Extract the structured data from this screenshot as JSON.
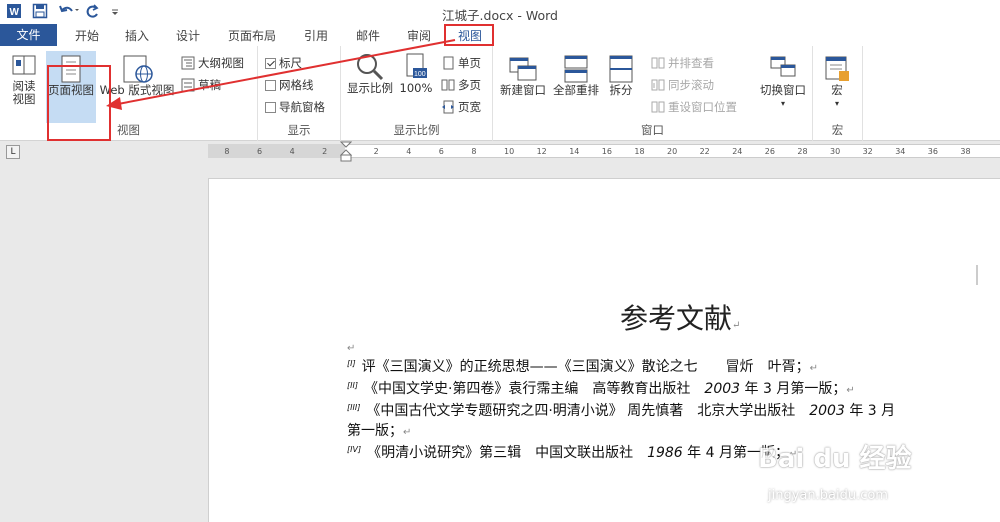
{
  "window": {
    "title": "江城子.docx - Word"
  },
  "qat": {
    "undo_icon": "undo-icon",
    "redo_icon": "redo-icon",
    "save_icon": "save-icon",
    "word_icon": "word-icon"
  },
  "tabs": {
    "file": "文件",
    "home": "开始",
    "insert": "插入",
    "design": "设计",
    "layout": "页面布局",
    "references": "引用",
    "mailings": "邮件",
    "review": "审阅",
    "view": "视图"
  },
  "ribbon": {
    "views": {
      "read_mode": [
        "阅读",
        "视图"
      ],
      "print_layout": "页面视图",
      "web_layout": "Web 版式视图",
      "outline": "大纲视图",
      "draft": "草稿",
      "label": "视图"
    },
    "show": {
      "ruler": "标尺",
      "gridlines": "网格线",
      "nav_pane": "导航窗格",
      "label": "显示",
      "ruler_checked": true,
      "gridlines_checked": false,
      "nav_checked": false
    },
    "zoom": {
      "zoom": "显示比例",
      "hundred": "100%",
      "one_page": "单页",
      "multi_page": "多页",
      "page_width": "页宽",
      "label": "显示比例"
    },
    "window": {
      "new_window": "新建窗口",
      "arrange_all": "全部重排",
      "split": "拆分",
      "side_by_side": "并排查看",
      "sync_scroll": "同步滚动",
      "reset_pos": "重设窗口位置",
      "switch_windows": "切换窗口",
      "label": "窗口"
    },
    "macros": {
      "macros": "宏",
      "label": "宏"
    }
  },
  "ruler": {
    "ticks_left": [
      "8",
      "6",
      "4",
      "2"
    ],
    "ticks_right": [
      "2",
      "4",
      "6",
      "8",
      "10",
      "12",
      "14",
      "16",
      "18",
      "20",
      "22",
      "24",
      "26",
      "28",
      "30",
      "32",
      "34",
      "36",
      "38",
      "40"
    ],
    "tab_selector": "L"
  },
  "document": {
    "title": "参考文献",
    "refs": [
      {
        "num": "[I]",
        "text": "评《三国演义》的正统思想——《三国演义》散论之七　　冒炘　叶胥；"
      },
      {
        "num": "[II]",
        "text": "《中国文学史·第四卷》袁行霈主编　高等教育出版社　",
        "year": "2003",
        "rest": " 年 3 月第一版；"
      },
      {
        "num": "[III]",
        "text": "《中国古代文学专题研究之四·明清小说》 周先慎著　北京大学出版社　",
        "year": "2003",
        "rest": " 年 3 月"
      },
      {
        "num": "",
        "text": "第一版；"
      },
      {
        "num": "[IV]",
        "text": "《明清小说研究》第三辑　中国文联出版社　",
        "year": "1986",
        "rest": " 年 4 月第一版；"
      }
    ]
  },
  "watermark": {
    "main": "Bai du 经验",
    "sub": "jingyan.baidu.com"
  },
  "colors": {
    "accent": "#2b579a",
    "highlight": "#c5dcf3",
    "annotation": "#e03030"
  }
}
